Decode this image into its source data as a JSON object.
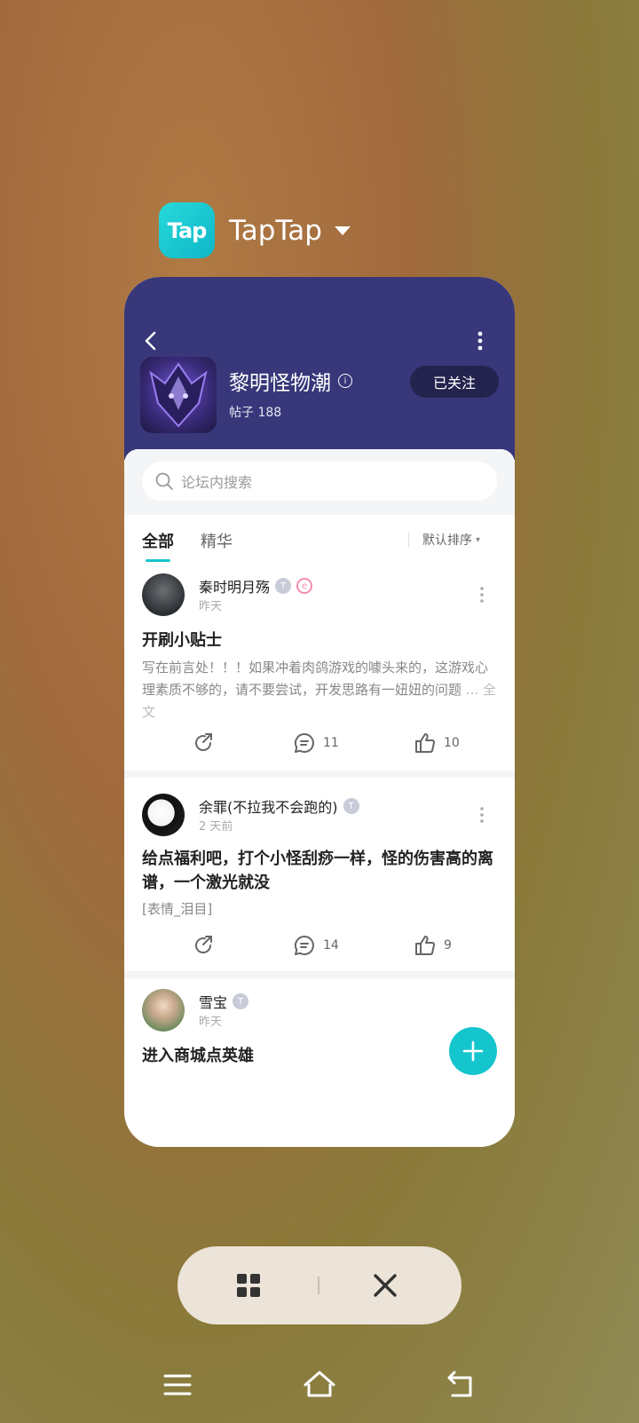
{
  "app_header": {
    "name": "TapTap",
    "logo_text": "Tap"
  },
  "forum": {
    "title": "黎明怪物潮",
    "post_count": "帖子 188",
    "follow_label": "已关注"
  },
  "search": {
    "placeholder": "论坛内搜索"
  },
  "tabs": {
    "all": "全部",
    "essence": "精华",
    "sort": "默认排序"
  },
  "posts": [
    {
      "author": "秦时明月殇",
      "time": "昨天",
      "title": "开刷小贴士",
      "excerpt": "写在前言处！！！如果冲着肉鸽游戏的噱头来的，这游戏心理素质不够的，请不要尝试，开发思路有一妞妞的问题",
      "more": "... 全文",
      "comments": "11",
      "likes": "10"
    },
    {
      "author": "余罪(不拉我不会跑的)",
      "time": "2 天前",
      "title": "给点福利吧，打个小怪刮痧一样，怪的伤害高的离谱，一个激光就没",
      "excerpt": "[表情_泪目]",
      "comments": "14",
      "likes": "9"
    },
    {
      "author": "雪宝",
      "time": "昨天",
      "title": "进入商城点英雄"
    }
  ],
  "badge_text": "T",
  "colors": {
    "accent": "#15c5ce",
    "banner": "#37377a"
  }
}
